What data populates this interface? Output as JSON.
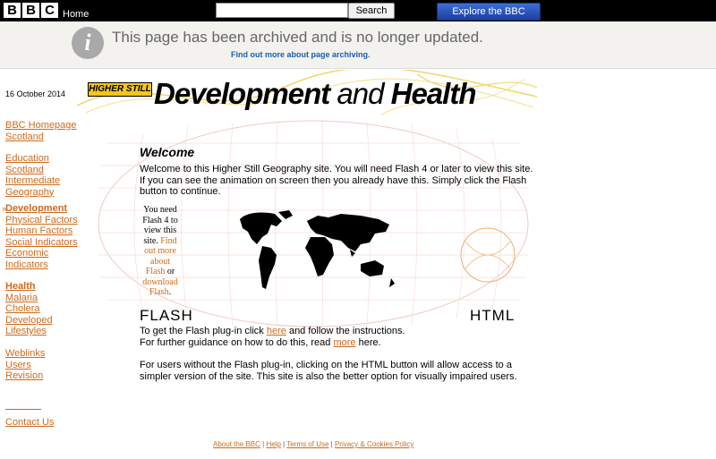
{
  "topbar": {
    "logo_letters": [
      "B",
      "B",
      "C"
    ],
    "home_label": "Home",
    "search_placeholder": "",
    "search_button": "Search",
    "explore_button": "Explore the BBC"
  },
  "archive": {
    "icon": "info-icon",
    "message": "This page has been archived and is no longer updated.",
    "link": "Find out more about page archiving."
  },
  "date": "16 October 2014",
  "banner": {
    "tag": "HIGHER STILL",
    "title_a": "Development",
    "title_and": " and ",
    "title_b": "Health"
  },
  "nav": {
    "group1": [
      "BBC Homepage",
      "Scotland"
    ],
    "group2": [
      "Education",
      "Scotland",
      "Intermediate",
      "Geography"
    ],
    "current": "Development",
    "group3": [
      "Physical Factors",
      "Human Factors",
      "Social Indicators",
      "Economic",
      "Indicators"
    ],
    "health": "Health",
    "group4": [
      "Malaria",
      "Cholera",
      "Developed",
      "Lifestyles"
    ],
    "group5": [
      "Weblinks",
      "Users",
      "Revision"
    ],
    "contact": "Contact Us"
  },
  "main": {
    "welcome": "Welcome",
    "intro": "Welcome to this Higher Still Geography site. You will need Flash 4 or later to view this site. If you can see the animation on screen then you already have this. Simply click the Flash button to continue.",
    "flash_note_text": "You need Flash 4 to view this site.",
    "flash_note_link1": "Find out more about Flash",
    "flash_note_or": "or",
    "flash_note_link2": "download Flash",
    "flash_note_end": ".",
    "flash_label": "FLASH",
    "html_label": "HTML",
    "plugin_pre": "To get the Flash plug-in click ",
    "plugin_link": "here",
    "plugin_post": " and follow the instructions.",
    "guidance_pre": "For further guidance on how to do this, read ",
    "guidance_link": "more",
    "guidance_post": " here.",
    "nonflash": "For users without the Flash plug-in, clicking on the HTML button will allow access to a simpler version of the site. This site is also the better option for visually impaired users."
  },
  "footer": {
    "links": [
      "About the BBC",
      "Help",
      "Terms of Use",
      "Privacy & Cookies Policy"
    ],
    "separator": " | "
  }
}
